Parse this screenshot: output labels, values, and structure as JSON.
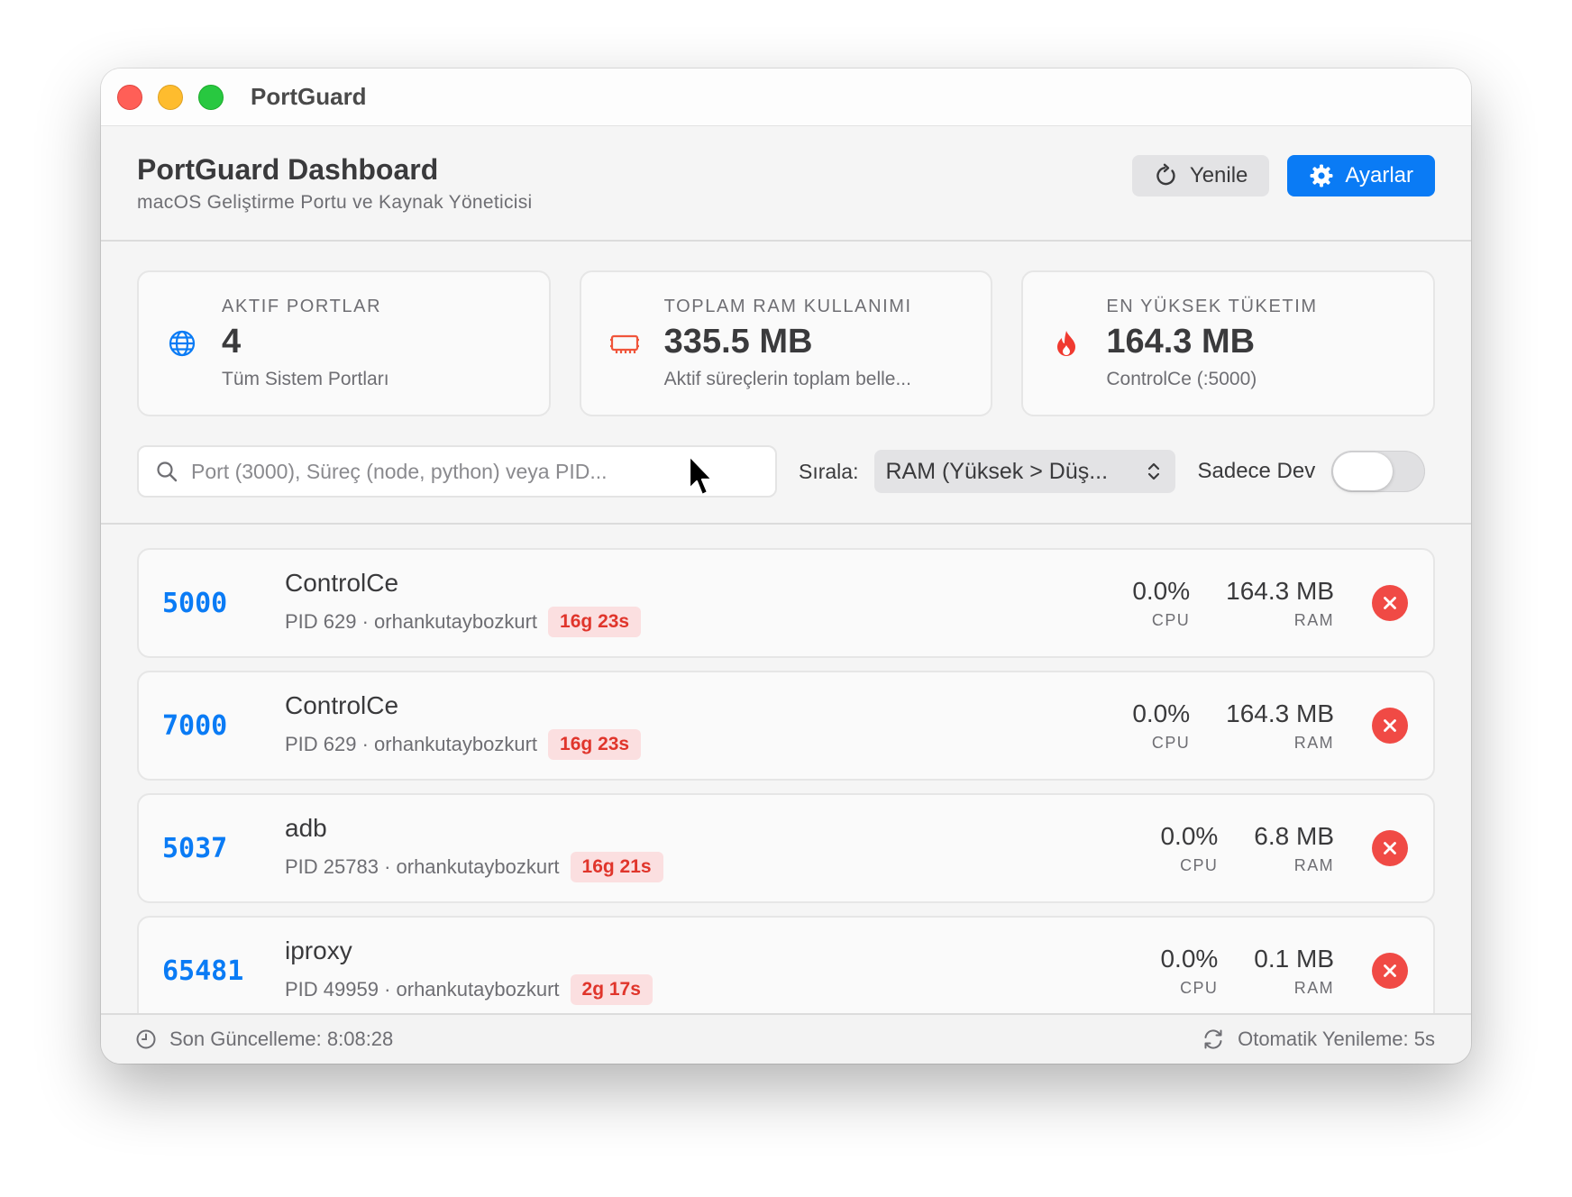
{
  "window": {
    "title": "PortGuard"
  },
  "header": {
    "title": "PortGuard Dashboard",
    "subtitle": "macOS Geliştirme Portu ve Kaynak Yöneticisi",
    "refresh_label": "Yenile",
    "settings_label": "Ayarlar"
  },
  "stats": [
    {
      "label": "AKTIF PORTLAR",
      "value": "4",
      "desc": "Tüm Sistem Portları",
      "icon": "globe-icon",
      "color": "#0a7bf5"
    },
    {
      "label": "TOPLAM RAM KULLANIMI",
      "value": "335.5 MB",
      "desc": "Aktif süreçlerin toplam belle...",
      "icon": "memory-chip-icon",
      "color": "#f0553b"
    },
    {
      "label": "EN YÜKSEK TÜKETIM",
      "value": "164.3 MB",
      "desc": "ControlCe (:5000)",
      "icon": "flame-icon",
      "color": "#f03a30"
    }
  ],
  "filters": {
    "search_placeholder": "Port (3000), Süreç (node, python) veya PID...",
    "search_value": "",
    "sort_label": "Sırala:",
    "sort_value": "RAM (Yüksek > Düş...",
    "toggle_label": "Sadece Dev",
    "toggle_on": false
  },
  "list": {
    "cpu_label": "CPU",
    "ram_label": "RAM",
    "rows": [
      {
        "port": "5000",
        "name": "ControlCe",
        "pid": "PID 629 · orhankutaybozkurt",
        "uptime": "16g 23s",
        "cpu": "0.0%",
        "ram": "164.3 MB"
      },
      {
        "port": "7000",
        "name": "ControlCe",
        "pid": "PID 629 · orhankutaybozkurt",
        "uptime": "16g 23s",
        "cpu": "0.0%",
        "ram": "164.3 MB"
      },
      {
        "port": "5037",
        "name": "adb",
        "pid": "PID 25783 · orhankutaybozkurt",
        "uptime": "16g 21s",
        "cpu": "0.0%",
        "ram": "6.8 MB"
      },
      {
        "port": "65481",
        "name": "iproxy",
        "pid": "PID 49959 · orhankutaybozkurt",
        "uptime": "2g 17s",
        "cpu": "0.0%",
        "ram": "0.1 MB"
      }
    ]
  },
  "footer": {
    "last_update": "Son Güncelleme: 8:08:28",
    "auto_refresh": "Otomatik Yenileme: 5s"
  },
  "colors": {
    "accent": "#0a7bf5",
    "danger": "#f04a45",
    "badge_bg": "#fbdfe0"
  }
}
